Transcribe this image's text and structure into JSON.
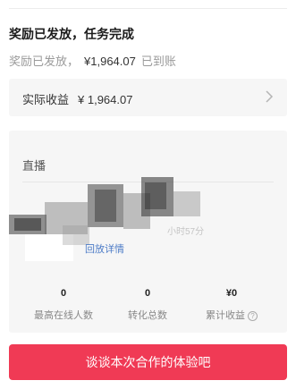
{
  "status": {
    "title": "奖励已发放，任务完成",
    "sub_prefix": "奖励已发放，",
    "amount": "¥1,964.07",
    "sub_suffix": "已到账"
  },
  "earnings": {
    "label": "实际收益",
    "value": "¥ 1,964.07",
    "icon": "chevron-right-icon"
  },
  "live": {
    "title": "直播",
    "time_fragment": "小时57分",
    "replay_link": "回放详情",
    "stats": [
      {
        "value": "0",
        "label": "最高在线人数"
      },
      {
        "value": "0",
        "label": "转化总数"
      },
      {
        "value": "¥0",
        "label": "累计收益",
        "icon": "help-icon"
      }
    ]
  },
  "feedback_button": {
    "label": "谈谈本次合作的体验吧"
  },
  "colors": {
    "accent": "#f03a55",
    "link": "#4d7cc7",
    "card_bg": "#f6f6f6"
  }
}
